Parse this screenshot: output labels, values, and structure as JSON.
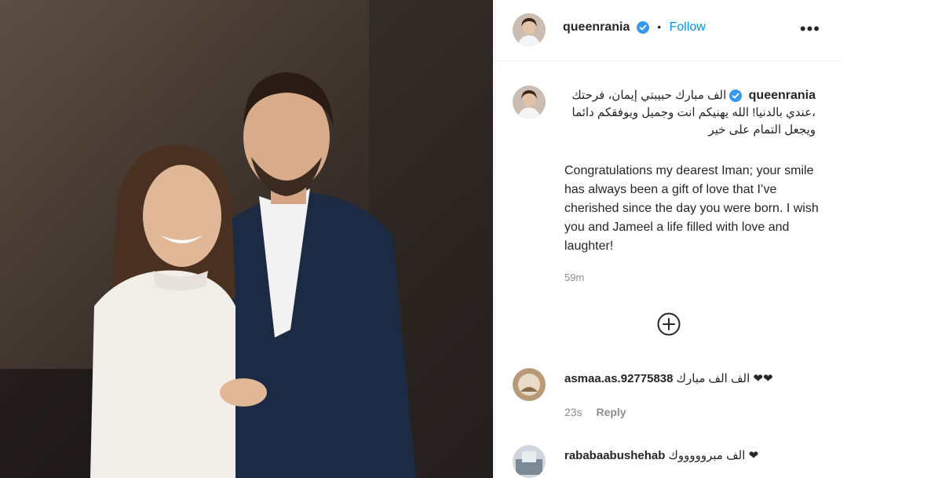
{
  "post": {
    "username": "queenrania",
    "follow_label": "Follow",
    "separator": "•",
    "more_label": "•••"
  },
  "caption": {
    "username": "queenrania",
    "arabic_line1": "الف مبارك حبيبتي إيمان، فرحتك",
    "arabic_line2": "عندي بالدنيا! الله يهنيكم انت وجميل ويوفقكم دائما،",
    "arabic_line3": "ويجعل التمام على خير",
    "english": "Congratulations my dearest Iman; your smile has always been a gift of love that I’ve cherished since the day you were born. I wish you and Jameel a life filled with love and laughter!",
    "time": "59m"
  },
  "comments": [
    {
      "username": "asmaa.as.92775838",
      "text": "الف الف مبارك ❤❤",
      "time": "23s",
      "reply_label": "Reply"
    },
    {
      "username": "rababaabushehab",
      "text": "الف مبروووووك ❤",
      "time": "",
      "reply_label": ""
    }
  ],
  "colors": {
    "accent": "#0095f6",
    "verified": "#3897f0",
    "muted": "#8e8e8e"
  }
}
